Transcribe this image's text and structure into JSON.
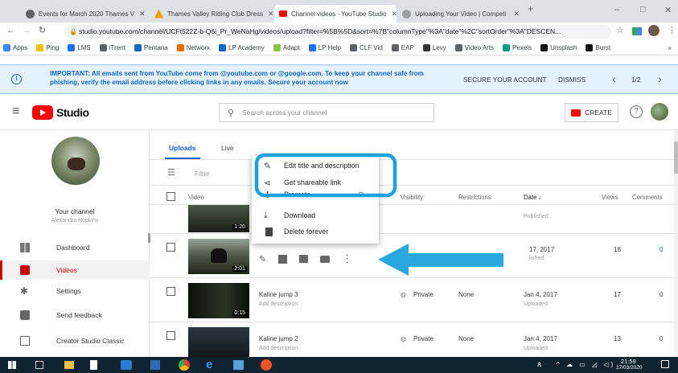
{
  "tabs": [
    {
      "title": "Events for March 2020 Thames V",
      "color": "#5f6368"
    },
    {
      "title": "Thames Valley Riding Club Dress",
      "color": "#f29900"
    },
    {
      "title": "Channel videos - YouTube Studio",
      "color": "#ff0000"
    },
    {
      "title": "Uploading Your Video | Competi",
      "color": "#9aa0a6"
    }
  ],
  "new_tab": "+",
  "window_controls": {
    "minimize": "–",
    "maximize": "□",
    "close": "✕"
  },
  "address": {
    "url": "studio.youtube.com/channel/UCFt522Z-b-Q6i_Pr_WeNaHg/videos/upload?filter=%5B%5D&sort=%7B\"columnType\"%3A\"date\"%2C\"sortOrder\"%3A\"DESCEN..."
  },
  "bookmarks": [
    {
      "label": "Apps",
      "color": "#4285f4"
    },
    {
      "label": "Ping",
      "color": "#fbbc04"
    },
    {
      "label": "LMS",
      "color": "#1a73e8"
    },
    {
      "label": "iTrent",
      "color": "#5f6368"
    },
    {
      "label": "Pentana",
      "color": "#1565c0"
    },
    {
      "label": "Networx",
      "color": "#ef6c00"
    },
    {
      "label": "LP Academy",
      "color": "#1565c0"
    },
    {
      "label": "Adapt",
      "color": "#8bc34a"
    },
    {
      "label": "LP Help",
      "color": "#1a73e8"
    },
    {
      "label": "CLF Vid",
      "color": "#5f6368"
    },
    {
      "label": "EAP",
      "color": "#5f6368"
    },
    {
      "label": "Levy",
      "color": "#333"
    },
    {
      "label": "Video Arts",
      "color": "#5f6368"
    },
    {
      "label": "Pexels",
      "color": "#05a081"
    },
    {
      "label": "Unsplash",
      "color": "#111"
    },
    {
      "label": "Burst",
      "color": "#111"
    }
  ],
  "bookmarks_more": "»",
  "banner": {
    "text": "IMPORTANT: All emails sent from YouTube come from @youtube.com or @google.com. To keep your channel safe from phishing, verify the email address before clicking links in any emails. Secure your account now",
    "secure": "SECURE YOUR ACCOUNT",
    "dismiss": "DISMISS",
    "page": "1/2",
    "prev": "‹",
    "next": "›"
  },
  "header": {
    "logo": "Studio",
    "search_placeholder": "Search across your channel",
    "create": "CREATE"
  },
  "channel": {
    "title": "Your channel",
    "name": "Alexandra Hopkins"
  },
  "nav": [
    {
      "label": "Dashboard",
      "active": false
    },
    {
      "label": "Videos",
      "active": true
    },
    {
      "label": "Settings",
      "active": false
    },
    {
      "label": "Send feedback",
      "active": false
    },
    {
      "label": "Creator Studio Classic",
      "active": false
    }
  ],
  "tabs_main": [
    {
      "label": "Uploads",
      "active": true
    },
    {
      "label": "Live",
      "active": false
    }
  ],
  "filter_placeholder": "Filter",
  "columns": {
    "video": "Video",
    "visibility": "Visibility",
    "restrictions": "Restrictions",
    "date": "Date",
    "views": "Views",
    "comments": "Comments"
  },
  "rows": [
    {
      "title": "",
      "desc": "",
      "duration": "1:20",
      "visibility": "",
      "restrictions": "",
      "date": "",
      "date_sub": "Published",
      "views": "",
      "comments": ""
    },
    {
      "title": "",
      "desc": "",
      "duration": "2:01",
      "visibility": "",
      "restrictions": "",
      "date": "17, 2017",
      "date_sub": "lished",
      "views": "18",
      "comments": "0"
    },
    {
      "title": "Kaline jump 3",
      "desc": "Add description",
      "duration": "0:15",
      "visibility": "Private",
      "restrictions": "None",
      "date": "Jan 4, 2017",
      "date_sub": "Uploaded",
      "views": "17",
      "comments": "0"
    },
    {
      "title": "Kaline jump 2",
      "desc": "Add description",
      "duration": "",
      "visibility": "Private",
      "restrictions": "None",
      "date": "Jan 4, 2017",
      "date_sub": "Uploaded",
      "views": "13",
      "comments": "0"
    }
  ],
  "menu": [
    {
      "label": "Edit title and description",
      "icon": "pencil-icon"
    },
    {
      "label": "Get shareable link",
      "icon": "share-icon"
    },
    {
      "label": "Promote",
      "icon": "promote-icon"
    },
    {
      "label": "Download",
      "icon": "download-icon"
    },
    {
      "label": "Delete forever",
      "icon": "trash-icon"
    }
  ],
  "menu_promote_tag": "⊡",
  "taskbar": {
    "time": "21:59",
    "date": "17/03/2020"
  },
  "colors": {
    "highlight": "#1aa1e0",
    "arrow": "#29a8e0",
    "yt_red": "#ff0000",
    "active_bg": "#f2f2f2"
  }
}
